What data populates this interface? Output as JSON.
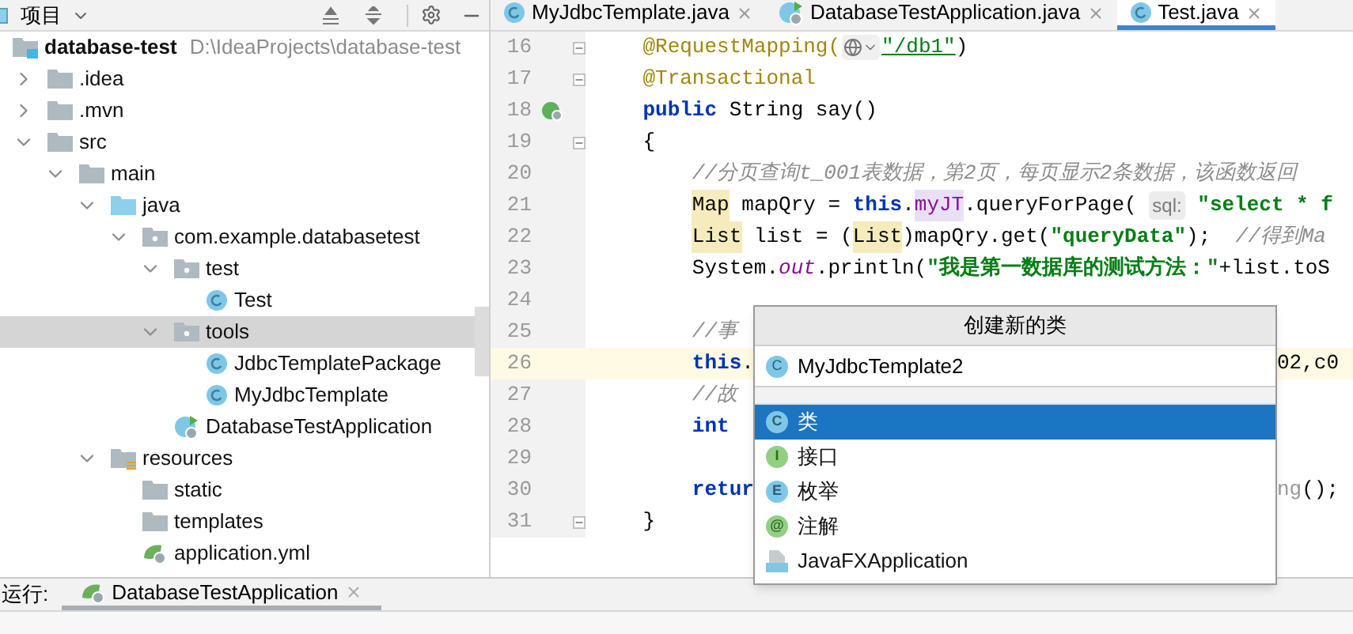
{
  "project_panel": {
    "title": "项目",
    "tree": [
      {
        "label": "database-test",
        "path": "D:\\IdeaProjects\\database-test",
        "kind": "module",
        "selected": false,
        "children": [
          {
            "label": ".idea",
            "kind": "folder",
            "expanded": false,
            "selected": false
          },
          {
            "label": ".mvn",
            "kind": "folder",
            "expanded": false,
            "selected": false
          },
          {
            "label": "src",
            "kind": "folder",
            "expanded": true,
            "selected": false,
            "children": [
              {
                "label": "main",
                "kind": "folder",
                "expanded": true,
                "selected": false,
                "children": [
                  {
                    "label": "java",
                    "kind": "source-folder",
                    "expanded": true,
                    "selected": false,
                    "children": [
                      {
                        "label": "com.example.databasetest",
                        "kind": "package",
                        "expanded": true,
                        "selected": false,
                        "children": [
                          {
                            "label": "test",
                            "kind": "package",
                            "expanded": true,
                            "selected": false,
                            "children": [
                              {
                                "label": "Test",
                                "kind": "class",
                                "selected": false
                              }
                            ]
                          },
                          {
                            "label": "tools",
                            "kind": "package",
                            "expanded": true,
                            "selected": true,
                            "children": [
                              {
                                "label": "JdbcTemplatePackage",
                                "kind": "class",
                                "selected": false
                              },
                              {
                                "label": "MyJdbcTemplate",
                                "kind": "class",
                                "selected": false
                              }
                            ]
                          },
                          {
                            "label": "DatabaseTestApplication",
                            "kind": "spring-class",
                            "selected": false
                          }
                        ]
                      }
                    ]
                  },
                  {
                    "label": "resources",
                    "kind": "resources",
                    "expanded": true,
                    "selected": false,
                    "children": [
                      {
                        "label": "static",
                        "kind": "folder",
                        "selected": false
                      },
                      {
                        "label": "templates",
                        "kind": "folder",
                        "selected": false
                      },
                      {
                        "label": "application.yml",
                        "kind": "spring-yml",
                        "selected": false
                      }
                    ]
                  }
                ]
              }
            ]
          }
        ]
      }
    ]
  },
  "editor_tabs": [
    {
      "label": "MyJdbcTemplate.java",
      "kind": "class",
      "selected": false
    },
    {
      "label": "DatabaseTestApplication.java",
      "kind": "spring-class",
      "selected": false
    },
    {
      "label": "Test.java",
      "kind": "class",
      "selected": true
    }
  ],
  "code_lines": [
    {
      "number": "16",
      "fold": true,
      "run": false,
      "current": false,
      "tokens": [
        {
          "text": "    @RequestMapping(",
          "kind": "annotation"
        },
        {
          "kind": "globe-inlay"
        },
        {
          "text": "\"/db1\"",
          "kind": "url"
        },
        {
          "text": ")",
          "kind": "plain"
        }
      ]
    },
    {
      "number": "17",
      "fold": true,
      "run": false,
      "current": false,
      "tokens": [
        {
          "text": "    @Transactional",
          "kind": "annotation"
        }
      ]
    },
    {
      "number": "18",
      "fold": false,
      "run": true,
      "current": false,
      "tokens": [
        {
          "text": "    public ",
          "kind": "keyword"
        },
        {
          "text": "String say()",
          "kind": "plain"
        }
      ]
    },
    {
      "number": "19",
      "fold": true,
      "run": false,
      "current": false,
      "tokens": [
        {
          "text": "    {",
          "kind": "plain"
        }
      ]
    },
    {
      "number": "20",
      "fold": false,
      "run": false,
      "current": false,
      "tokens": [
        {
          "text": "        //分页查询t_001表数据，第2页，每页显示2条数据，该函数返回",
          "kind": "comment"
        }
      ]
    },
    {
      "number": "21",
      "fold": false,
      "run": false,
      "current": false,
      "tokens": [
        {
          "text": "        Map",
          "kind": "marked"
        },
        {
          "text": " mapQry = ",
          "kind": "plain"
        },
        {
          "text": "this",
          "kind": "keyword"
        },
        {
          "text": ".",
          "kind": "plain"
        },
        {
          "text": "myJT",
          "kind": "field"
        },
        {
          "text": ".queryForPage( ",
          "kind": "plain"
        },
        {
          "text": "sql:",
          "kind": "hint"
        },
        {
          "text": " \"select * f",
          "kind": "string"
        }
      ]
    },
    {
      "number": "22",
      "fold": false,
      "run": false,
      "current": false,
      "tokens": [
        {
          "text": "        List",
          "kind": "marked"
        },
        {
          "text": " list = (",
          "kind": "plain"
        },
        {
          "text": "List",
          "kind": "marked"
        },
        {
          "text": ")mapQry.get(",
          "kind": "plain"
        },
        {
          "text": "\"queryData\"",
          "kind": "string"
        },
        {
          "text": ");  ",
          "kind": "plain"
        },
        {
          "text": "//得到Ma",
          "kind": "comment"
        }
      ]
    },
    {
      "number": "23",
      "fold": false,
      "run": false,
      "current": false,
      "tokens": [
        {
          "text": "        System.",
          "kind": "plain"
        },
        {
          "text": "out",
          "kind": "static"
        },
        {
          "text": ".println(",
          "kind": "plain"
        },
        {
          "text": "\"我是第一数据库的测试方法：\"",
          "kind": "string"
        },
        {
          "text": "+list.toS",
          "kind": "plain"
        }
      ]
    },
    {
      "number": "24",
      "fold": false,
      "run": false,
      "current": false
    },
    {
      "number": "25",
      "fold": false,
      "run": false,
      "current": false,
      "tokens": [
        {
          "text": "        //事",
          "kind": "comment"
        }
      ]
    },
    {
      "number": "26",
      "fold": false,
      "run": false,
      "current": true,
      "tokens": [
        {
          "text": "        this",
          "kind": "keyword"
        },
        {
          "text": ".",
          "kind": "plain"
        }
      ],
      "right": [
        {
          "text": "02,c0",
          "kind": "plain"
        }
      ]
    },
    {
      "number": "27",
      "fold": false,
      "run": false,
      "current": false,
      "tokens": [
        {
          "text": "        //故",
          "kind": "comment"
        }
      ]
    },
    {
      "number": "28",
      "fold": false,
      "run": false,
      "current": false,
      "tokens": [
        {
          "text": "        int",
          "kind": "keyword"
        }
      ]
    },
    {
      "number": "29",
      "fold": false,
      "run": false,
      "current": false
    },
    {
      "number": "30",
      "fold": false,
      "run": false,
      "current": false,
      "tokens": [
        {
          "text": "        retur",
          "kind": "keyword"
        }
      ],
      "right": [
        {
          "text": "ng",
          "kind": "dim"
        },
        {
          "text": "();",
          "kind": "plain"
        }
      ]
    },
    {
      "number": "31",
      "fold": true,
      "run": false,
      "current": false,
      "tokens": [
        {
          "text": "    }",
          "kind": "plain"
        }
      ]
    }
  ],
  "popup": {
    "title": "创建新的类",
    "value": "MyJdbcTemplate2",
    "value_icon": "C",
    "items": [
      {
        "label": "类",
        "kind": "class",
        "icon_text": "C",
        "selected": true
      },
      {
        "label": "接口",
        "kind": "interface",
        "icon_text": "I",
        "selected": false
      },
      {
        "label": "枚举",
        "kind": "enum",
        "icon_text": "E",
        "selected": false
      },
      {
        "label": "注解",
        "kind": "annotation",
        "icon_text": "@",
        "selected": false
      },
      {
        "label": "JavaFXApplication",
        "kind": "javafx",
        "selected": false
      }
    ]
  },
  "run_panel": {
    "label": "运行:",
    "tabs": [
      {
        "label": "DatabaseTestApplication",
        "selected": true
      }
    ]
  }
}
